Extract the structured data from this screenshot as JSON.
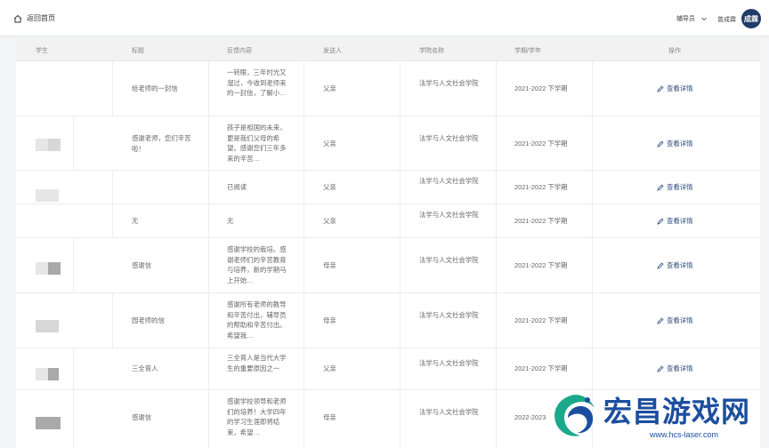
{
  "header": {
    "back_label": "返回首页",
    "role_label": "辅导员",
    "user_name": "曾成霖",
    "avatar_text": "成霖"
  },
  "table": {
    "columns": [
      "学生",
      "标题",
      "反馈内容",
      "发送人",
      "学院名称",
      "学期/学年",
      "操作"
    ],
    "rows": [
      {
        "title": "给老师的一封信",
        "content": "一转眼，三年时光又溜过，今收到老师来的一封信，了解小…",
        "sender": "父亲",
        "college": "法学与人文社会学院",
        "term": "2021-2022 下学期",
        "action": "查看详情"
      },
      {
        "title": "感谢老师，您们辛苦啦！",
        "content": "孩子是祖国的未来，更是我们父母的希望。感谢您们三年多来的辛苦…",
        "sender": "父亲",
        "college": "法学与人文社会学院",
        "term": "2021-2022 下学期",
        "action": "查看详情"
      },
      {
        "title": "",
        "content": "已阅读",
        "sender": "父亲",
        "college": "法学与人文社会学院",
        "term": "2021-2022 下学期",
        "action": "查看详情"
      },
      {
        "title": "无",
        "content": "无",
        "sender": "父亲",
        "college": "法学与人文社会学院",
        "term": "2021-2022 下学期",
        "action": "查看详情"
      },
      {
        "title": "感谢信",
        "content": "感谢学校的栽培。感谢老师们的辛苦教育与培养，新的学期马上开始…",
        "sender": "母亲",
        "college": "法学与人文社会学院",
        "term": "2021-2022 下学期",
        "action": "查看详情"
      },
      {
        "title": "园老师的信",
        "content": "感谢所有老师的教导和辛苦付出，辅导员的帮助和辛苦付出。希望我…",
        "sender": "母亲",
        "college": "法学与人文社会学院",
        "term": "2021-2022 下学期",
        "action": "查看详情"
      },
      {
        "title": "三全育人",
        "content": "三全育人是当代大学生的重要原因之一",
        "sender": "父亲",
        "college": "法学与人文社会学院",
        "term": "2021-2022 下学期",
        "action": "查看详情"
      },
      {
        "title": "感谢信",
        "content": "感谢学校领导和老师们的培养！大学四年的学习生涯即将结束，希望…",
        "sender": "母亲",
        "college": "法学与人文社会学院",
        "term": "2022-2023",
        "action": "查看详情"
      }
    ]
  },
  "watermark": {
    "title": "宏昌游戏网",
    "url": "www.hcs-laser.com"
  },
  "colors": {
    "accent": "#2b4a7a",
    "avatar_bg": "#1f3c6b",
    "watermark": "#1c4e9e"
  }
}
